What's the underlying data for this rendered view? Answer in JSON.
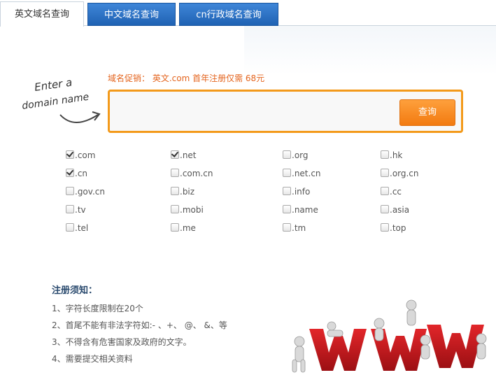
{
  "tabs": [
    {
      "label": "英文域名查询",
      "active": true
    },
    {
      "label": "中文域名查询",
      "active": false
    },
    {
      "label": "cn行政域名查询",
      "active": false
    }
  ],
  "hint": {
    "line1": "Enter a",
    "line2": "domain name"
  },
  "promo": "域名促销： 英文.com 首年注册仅需 68元",
  "search": {
    "placeholder": "",
    "button": "查询"
  },
  "suffixes": [
    [
      {
        "label": ".com",
        "checked": true
      },
      {
        "label": ".net",
        "checked": true
      },
      {
        "label": ".org",
        "checked": false
      },
      {
        "label": ".hk",
        "checked": false
      }
    ],
    [
      {
        "label": ".cn",
        "checked": true
      },
      {
        "label": ".com.cn",
        "checked": false
      },
      {
        "label": ".net.cn",
        "checked": false
      },
      {
        "label": ".org.cn",
        "checked": false
      }
    ],
    [
      {
        "label": ".gov.cn",
        "checked": false
      },
      {
        "label": ".biz",
        "checked": false
      },
      {
        "label": ".info",
        "checked": false
      },
      {
        "label": ".cc",
        "checked": false
      }
    ],
    [
      {
        "label": ".tv",
        "checked": false
      },
      {
        "label": ".mobi",
        "checked": false
      },
      {
        "label": ".name",
        "checked": false
      },
      {
        "label": ".asia",
        "checked": false
      }
    ],
    [
      {
        "label": ".tel",
        "checked": false
      },
      {
        "label": ".me",
        "checked": false
      },
      {
        "label": ".tm",
        "checked": false
      },
      {
        "label": ".top",
        "checked": false
      }
    ]
  ],
  "notice": {
    "title": "注册须知：",
    "items": [
      "1、字符长度限制在20个",
      "2、首尾不能有非法字符如:- 、+、 @、 &、等",
      "3、不得含有危害国家及政府的文字。",
      "4、需要提交相关资料"
    ]
  },
  "colors": {
    "accent": "#f39a1b",
    "tab_blue": "#2f73c4",
    "promo": "#e4651f"
  }
}
